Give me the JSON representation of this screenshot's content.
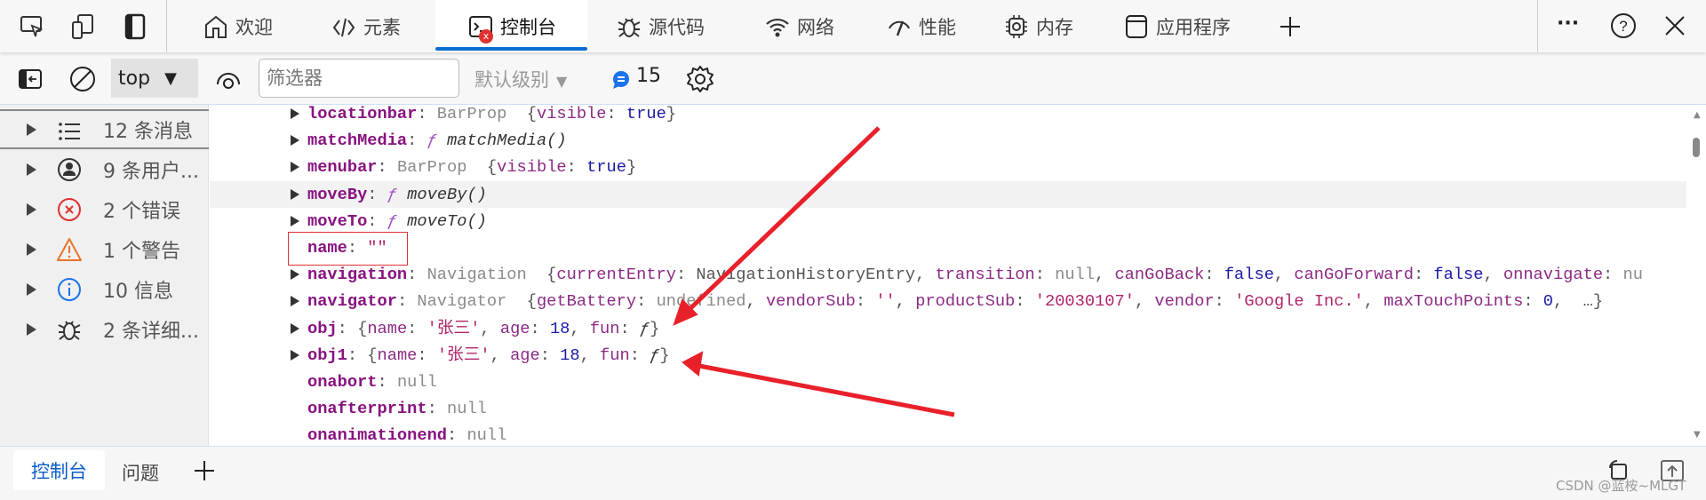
{
  "tabs": [
    {
      "label": "欢迎",
      "icon": "home-icon"
    },
    {
      "label": "元素",
      "icon": "code-icon"
    },
    {
      "label": "控制台",
      "icon": "console-icon",
      "active": true,
      "badge": "x"
    },
    {
      "label": "源代码",
      "icon": "bug-icon"
    },
    {
      "label": "网络",
      "icon": "wifi-icon"
    },
    {
      "label": "性能",
      "icon": "gauge-icon"
    },
    {
      "label": "内存",
      "icon": "chip-icon"
    },
    {
      "label": "应用程序",
      "icon": "window-icon"
    }
  ],
  "toolbar": {
    "context": "top",
    "filter_placeholder": "筛选器",
    "level": "默认级别",
    "message_count": "15"
  },
  "sidebar": [
    {
      "label": "12 条消息",
      "icon": "list-icon"
    },
    {
      "label": "9 条用户...",
      "icon": "user-icon"
    },
    {
      "label": "2 个错误",
      "icon": "error-icon"
    },
    {
      "label": "1 个警告",
      "icon": "warning-icon"
    },
    {
      "label": "10 信息",
      "icon": "info-icon"
    },
    {
      "label": "2 条详细...",
      "icon": "bug-icon"
    }
  ],
  "colors": {
    "accent": "#0a6fd0",
    "error": "#e03030",
    "warning": "#e8742a",
    "info": "#1a73e8",
    "annotation": "#e8202a"
  },
  "lines": [
    {
      "expand": true,
      "tokens": [
        [
          "locationbar",
          "k"
        ],
        [
          ": ",
          "p"
        ],
        [
          "BarProp",
          "g"
        ],
        [
          "  {",
          "p"
        ],
        [
          "visible",
          "pk"
        ],
        [
          ": ",
          "p"
        ],
        [
          "true",
          "b"
        ],
        [
          "}",
          "p"
        ]
      ]
    },
    {
      "expand": true,
      "tokens": [
        [
          "matchMedia",
          "k"
        ],
        [
          ": ",
          "p"
        ],
        [
          "ƒ ",
          "f"
        ],
        [
          "matchMedia()",
          "fn"
        ]
      ]
    },
    {
      "expand": true,
      "tokens": [
        [
          "menubar",
          "k"
        ],
        [
          ": ",
          "p"
        ],
        [
          "BarProp",
          "g"
        ],
        [
          "  {",
          "p"
        ],
        [
          "visible",
          "pk"
        ],
        [
          ": ",
          "p"
        ],
        [
          "true",
          "b"
        ],
        [
          "}",
          "p"
        ]
      ]
    },
    {
      "expand": true,
      "highlight": true,
      "tokens": [
        [
          "moveBy",
          "k"
        ],
        [
          ": ",
          "p"
        ],
        [
          "ƒ ",
          "f"
        ],
        [
          "moveBy()",
          "fn"
        ]
      ]
    },
    {
      "expand": true,
      "tokens": [
        [
          "moveTo",
          "k"
        ],
        [
          ": ",
          "p"
        ],
        [
          "ƒ ",
          "f"
        ],
        [
          "moveTo()",
          "fn"
        ]
      ]
    },
    {
      "expand": false,
      "tokens": [
        [
          "name",
          "k"
        ],
        [
          ": ",
          "p"
        ],
        [
          "\"\"",
          "s"
        ]
      ]
    },
    {
      "expand": true,
      "tokens": [
        [
          "navigation",
          "k"
        ],
        [
          ": ",
          "p"
        ],
        [
          "Navigation",
          "g"
        ],
        [
          "  {",
          "p"
        ],
        [
          "currentEntry",
          "pk"
        ],
        [
          ": ",
          "p"
        ],
        [
          "NavigationHistoryEntry",
          "p"
        ],
        [
          ", ",
          "p"
        ],
        [
          "transition",
          "pk"
        ],
        [
          ": ",
          "p"
        ],
        [
          "null",
          "g"
        ],
        [
          ", ",
          "p"
        ],
        [
          "canGoBack",
          "pk"
        ],
        [
          ": ",
          "p"
        ],
        [
          "false",
          "b"
        ],
        [
          ", ",
          "p"
        ],
        [
          "canGoForward",
          "pk"
        ],
        [
          ": ",
          "p"
        ],
        [
          "false",
          "b"
        ],
        [
          ", ",
          "p"
        ],
        [
          "onnavigate",
          "pk"
        ],
        [
          ": ",
          "p"
        ],
        [
          "nu",
          "g"
        ]
      ]
    },
    {
      "expand": true,
      "tokens": [
        [
          "navigator",
          "k"
        ],
        [
          ": ",
          "p"
        ],
        [
          "Navigator",
          "g"
        ],
        [
          "  {",
          "p"
        ],
        [
          "getBattery",
          "pk"
        ],
        [
          ": ",
          "p"
        ],
        [
          "undefined",
          "g"
        ],
        [
          ", ",
          "p"
        ],
        [
          "vendorSub",
          "pk"
        ],
        [
          ": ",
          "p"
        ],
        [
          "''",
          "s"
        ],
        [
          ", ",
          "p"
        ],
        [
          "productSub",
          "pk"
        ],
        [
          ": ",
          "p"
        ],
        [
          "'20030107'",
          "s"
        ],
        [
          ", ",
          "p"
        ],
        [
          "vendor",
          "pk"
        ],
        [
          ": ",
          "p"
        ],
        [
          "'Google Inc.'",
          "s"
        ],
        [
          ", ",
          "p"
        ],
        [
          "maxTouchPoints",
          "pk"
        ],
        [
          ": ",
          "p"
        ],
        [
          "0",
          "b"
        ],
        [
          ",  …}",
          "p"
        ]
      ]
    },
    {
      "expand": true,
      "tokens": [
        [
          "obj",
          "k"
        ],
        [
          ": ",
          "p"
        ],
        [
          "{",
          "p"
        ],
        [
          "name",
          "pk"
        ],
        [
          ": ",
          "p"
        ],
        [
          "'张三'",
          "s"
        ],
        [
          ", ",
          "p"
        ],
        [
          "age",
          "pk"
        ],
        [
          ": ",
          "p"
        ],
        [
          "18",
          "b"
        ],
        [
          ", ",
          "p"
        ],
        [
          "fun",
          "pk"
        ],
        [
          ": ",
          "p"
        ],
        [
          "ƒ",
          "fn"
        ],
        [
          "}",
          "p"
        ]
      ]
    },
    {
      "expand": true,
      "tokens": [
        [
          "obj1",
          "k"
        ],
        [
          ": ",
          "p"
        ],
        [
          "{",
          "p"
        ],
        [
          "name",
          "pk"
        ],
        [
          ": ",
          "p"
        ],
        [
          "'张三'",
          "s"
        ],
        [
          ", ",
          "p"
        ],
        [
          "age",
          "pk"
        ],
        [
          ": ",
          "p"
        ],
        [
          "18",
          "b"
        ],
        [
          ", ",
          "p"
        ],
        [
          "fun",
          "pk"
        ],
        [
          ": ",
          "p"
        ],
        [
          "ƒ",
          "fn"
        ],
        [
          "}",
          "p"
        ]
      ]
    },
    {
      "expand": false,
      "tokens": [
        [
          "onabort",
          "k"
        ],
        [
          ": ",
          "p"
        ],
        [
          "null",
          "g"
        ]
      ]
    },
    {
      "expand": false,
      "tokens": [
        [
          "onafterprint",
          "k"
        ],
        [
          ": ",
          "p"
        ],
        [
          "null",
          "g"
        ]
      ]
    },
    {
      "expand": false,
      "tokens": [
        [
          "onanimationend",
          "k"
        ],
        [
          ": ",
          "p"
        ],
        [
          "null",
          "g"
        ]
      ]
    }
  ],
  "bottom": {
    "tabs": [
      "控制台",
      "问题"
    ],
    "watermark": "CSDN @蓝桉~MLGT"
  }
}
